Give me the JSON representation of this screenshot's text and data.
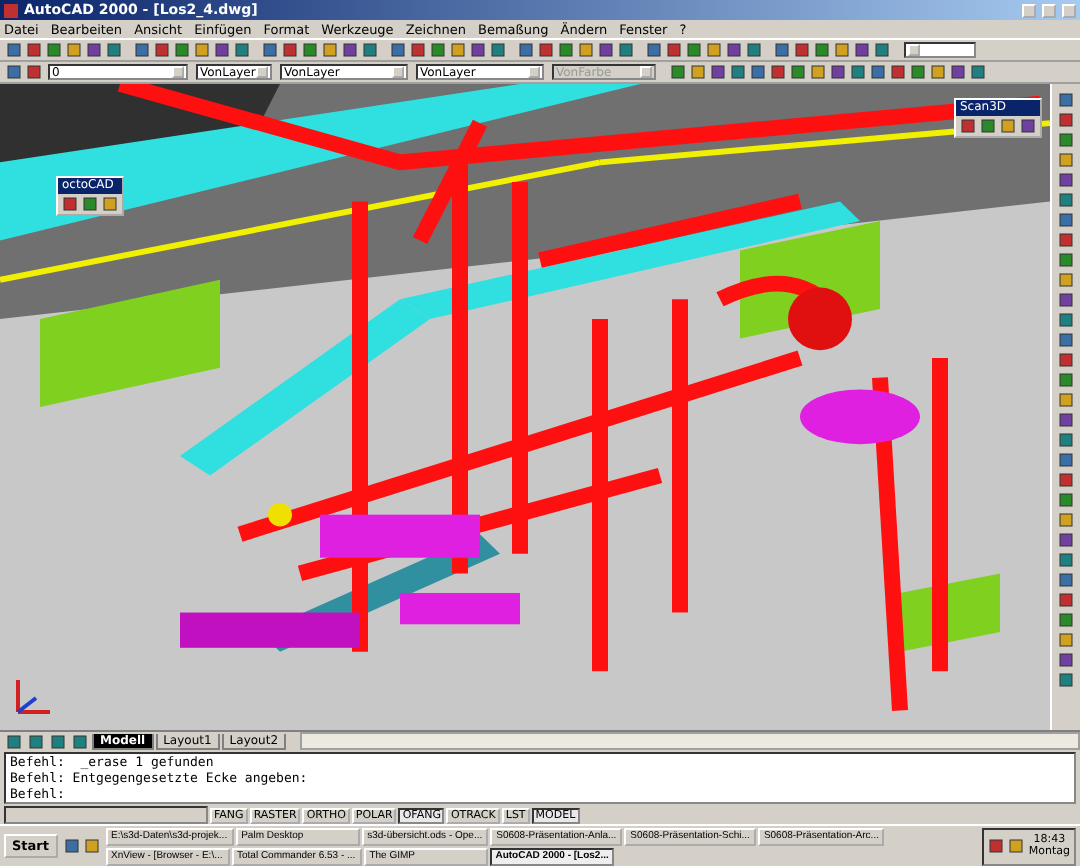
{
  "window": {
    "title": "AutoCAD 2000 - [Los2_4.dwg]"
  },
  "menu": [
    "Datei",
    "Bearbeiten",
    "Ansicht",
    "Einfügen",
    "Format",
    "Werkzeuge",
    "Zeichnen",
    "Bemaßung",
    "Ändern",
    "Fenster",
    "?"
  ],
  "layer_controls": [
    {
      "value": "0",
      "disabled": false
    },
    {
      "value": "VonLayer",
      "disabled": false
    },
    {
      "value": "VonLayer",
      "disabled": false
    },
    {
      "value": "VonLayer",
      "disabled": false
    },
    {
      "value": "VonFarbe",
      "disabled": true
    }
  ],
  "floating_toolbars": [
    {
      "title": "octoCAD"
    },
    {
      "title": "Scan3D"
    }
  ],
  "model_tabs": [
    {
      "label": "Modell",
      "selected": true
    },
    {
      "label": "Layout1",
      "selected": false
    },
    {
      "label": "Layout2",
      "selected": false
    }
  ],
  "command_lines": [
    "Befehl:  _erase 1 gefunden",
    "Befehl: Entgegengesetzte Ecke angeben:",
    "Befehl:"
  ],
  "status_bar": {
    "toggles": [
      {
        "label": "FANG",
        "on": false
      },
      {
        "label": "RASTER",
        "on": false
      },
      {
        "label": "ORTHO",
        "on": false
      },
      {
        "label": "POLAR",
        "on": false
      },
      {
        "label": "OFANG",
        "on": true
      },
      {
        "label": "OTRACK",
        "on": false
      },
      {
        "label": "LST",
        "on": false
      },
      {
        "label": "MODEL",
        "on": true
      }
    ]
  },
  "taskbar": {
    "start": "Start",
    "rows": [
      [
        {
          "label": "E:\\s3d-Daten\\s3d-projek...",
          "selected": false
        },
        {
          "label": "Palm Desktop",
          "selected": false
        },
        {
          "label": "s3d-übersicht.ods - Ope...",
          "selected": false
        },
        {
          "label": "S0608-Präsentation-Anla...",
          "selected": false
        },
        {
          "label": "S0608-Präsentation-Schi...",
          "selected": false
        },
        {
          "label": "S0608-Präsentation-Arc...",
          "selected": false
        }
      ],
      [
        {
          "label": "XnView - [Browser - E:\\...",
          "selected": false
        },
        {
          "label": "Total Commander 6.53 - ...",
          "selected": false
        },
        {
          "label": "The GIMP",
          "selected": false
        },
        {
          "label": "AutoCAD 2000 - [Los2...",
          "selected": true
        }
      ]
    ],
    "clock": "18:43",
    "day": "Montag"
  }
}
